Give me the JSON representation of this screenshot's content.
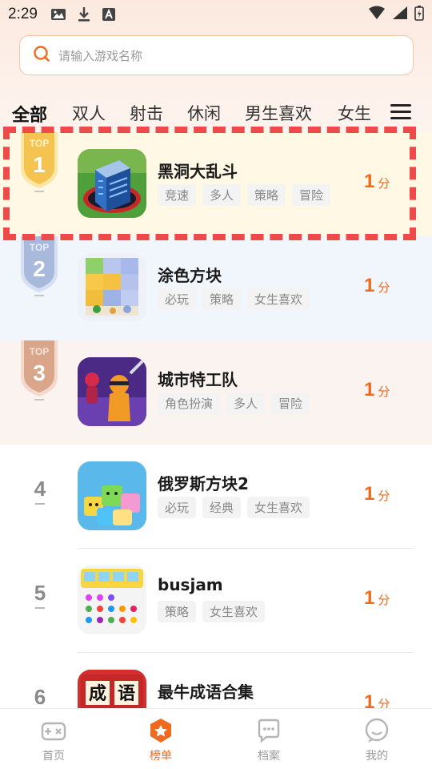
{
  "status_bar": {
    "time": "2:29"
  },
  "search": {
    "placeholder": "请输入游戏名称"
  },
  "tabs": [
    {
      "label": "全部",
      "active": true
    },
    {
      "label": "双人",
      "active": false
    },
    {
      "label": "射击",
      "active": false
    },
    {
      "label": "休闲",
      "active": false
    },
    {
      "label": "男生喜欢",
      "active": false
    },
    {
      "label": "女生",
      "active": false
    }
  ],
  "ranking": [
    {
      "rank": "1",
      "badge_text": "TOP",
      "name": "黑洞大乱斗",
      "tags": [
        "竞速",
        "多人",
        "策略",
        "冒险"
      ],
      "score": "1",
      "score_unit": "分"
    },
    {
      "rank": "2",
      "badge_text": "TOP",
      "name": "涂色方块",
      "tags": [
        "必玩",
        "策略",
        "女生喜欢"
      ],
      "score": "1",
      "score_unit": "分"
    },
    {
      "rank": "3",
      "badge_text": "TOP",
      "name": "城市特工队",
      "tags": [
        "角色扮演",
        "多人",
        "冒险"
      ],
      "score": "1",
      "score_unit": "分"
    },
    {
      "rank": "4",
      "name": "俄罗斯方块2",
      "tags": [
        "必玩",
        "经典",
        "女生喜欢"
      ],
      "score": "1",
      "score_unit": "分"
    },
    {
      "rank": "5",
      "name": "busjam",
      "tags": [
        "策略",
        "女生喜欢"
      ],
      "score": "1",
      "score_unit": "分"
    },
    {
      "rank": "6",
      "name": "最牛成语合集",
      "tags": [],
      "score": "1",
      "score_unit": "分",
      "icon_text": [
        "成",
        "语"
      ]
    }
  ],
  "bottom_nav": [
    {
      "label": "首页",
      "active": false,
      "icon": "gamepad-icon"
    },
    {
      "label": "榜单",
      "active": true,
      "icon": "ranking-icon"
    },
    {
      "label": "档案",
      "active": false,
      "icon": "chat-icon"
    },
    {
      "label": "我的",
      "active": false,
      "icon": "profile-icon"
    }
  ],
  "colors": {
    "accent": "#ee6a1e",
    "highlight": "#ee4a4a",
    "gold": "#f2c14a",
    "silver": "#a9b9dc",
    "bronze": "#d9a58b"
  }
}
